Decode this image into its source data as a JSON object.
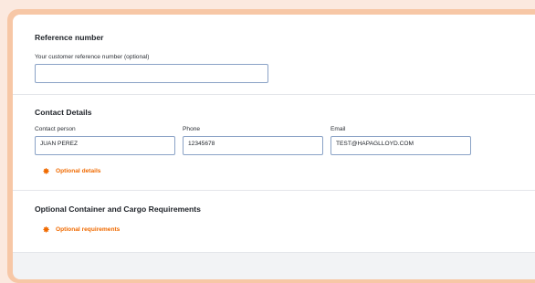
{
  "reference": {
    "title": "Reference number",
    "field_label": "Your customer reference number (optional)",
    "field_value": ""
  },
  "contact": {
    "title": "Contact Details",
    "person_label": "Contact person",
    "person_value": "JUAN PEREZ",
    "phone_label": "Phone",
    "phone_value": "12345678",
    "email_label": "Email",
    "email_value": "TEST@HAPAGLLOYD.COM",
    "optional_link": "Optional details"
  },
  "cargo": {
    "title": "Optional Container and Cargo Requirements",
    "optional_link": "Optional requirements"
  },
  "colors": {
    "accent": "#f06a00",
    "frame": "#f7c7a6",
    "input_border": "#8aa2c6"
  }
}
